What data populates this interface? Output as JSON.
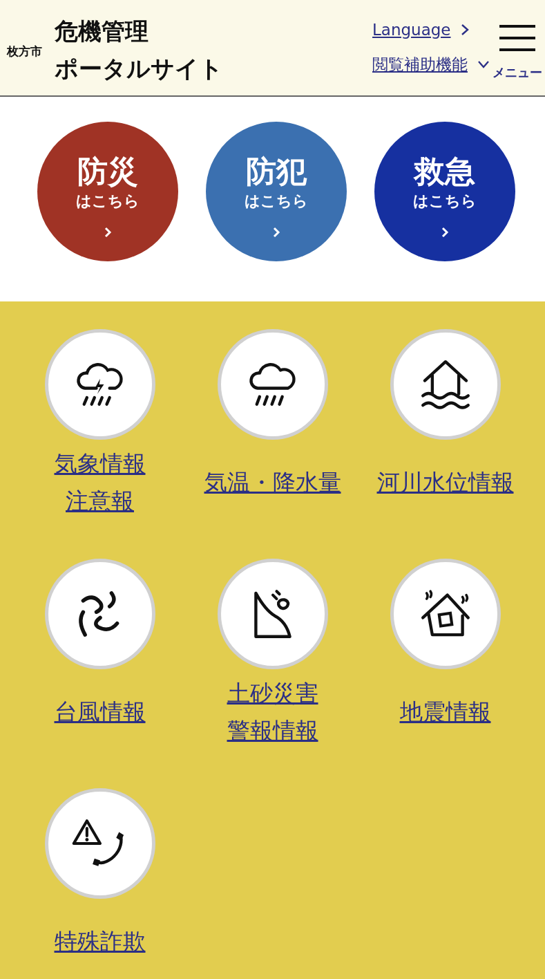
{
  "header": {
    "city": "枚方市",
    "title_lines": [
      "危機管理",
      "ポータルサイト"
    ],
    "language_link": "Language",
    "accessibility_link": "閲覧補助機能",
    "menu_label": "メニュー"
  },
  "categories": [
    {
      "title": "防災",
      "subtitle": "はこちら",
      "color": "#a03325"
    },
    {
      "title": "防犯",
      "subtitle": "はこちら",
      "color": "#3b70b0"
    },
    {
      "title": "救急",
      "subtitle": "はこちら",
      "color": "#1630a0"
    }
  ],
  "info_links": [
    {
      "lines": [
        "気象情報",
        "注意報"
      ]
    },
    {
      "lines": [
        "気温・降水量"
      ]
    },
    {
      "lines": [
        "河川水位情報"
      ]
    },
    {
      "lines": [
        "台風情報"
      ]
    },
    {
      "lines": [
        "土砂災害",
        "警報情報"
      ]
    },
    {
      "lines": [
        "地震情報"
      ]
    },
    {
      "lines": [
        "特殊詐欺"
      ]
    }
  ]
}
